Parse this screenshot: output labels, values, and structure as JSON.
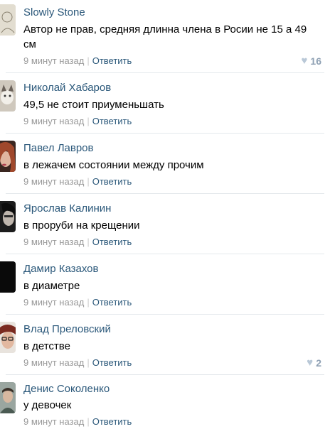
{
  "colors": {
    "author": "#2b587a",
    "meta": "#999999",
    "divider": "#e4e8ec",
    "like": "#8fa1b4"
  },
  "comments": [
    {
      "author": "Slowly Stone",
      "text": "Автор не прав, средняя длинна члена в Росии не 15 а 49 см",
      "time": "9 минут назад",
      "separator": "|",
      "reply": "Ответить",
      "likes": "16",
      "like_icon": "heart-icon",
      "avatar": "avatar-sketch"
    },
    {
      "author": "Николай Хабаров",
      "text": "49,5 не стоит приуменьшать",
      "time": "9 минут назад",
      "separator": "|",
      "reply": "Ответить",
      "avatar": "avatar-cat"
    },
    {
      "author": "Павел Лавров",
      "text": "в лежачем состоянии между прочим",
      "time": "9 минут назад",
      "separator": "|",
      "reply": "Ответить",
      "avatar": "avatar-woman-redhead"
    },
    {
      "author": "Ярослав Калинин",
      "text": "в проруби на крещении",
      "time": "9 минут назад",
      "separator": "|",
      "reply": "Ответить",
      "avatar": "avatar-dark-face"
    },
    {
      "author": "Дамир Казахов",
      "text": "в диаметре",
      "time": "9 минут назад",
      "separator": "|",
      "reply": "Ответить",
      "avatar": "avatar-black"
    },
    {
      "author": "Влад Преловский",
      "text": "в детстве",
      "time": "9 минут назад",
      "separator": "|",
      "reply": "Ответить",
      "likes": "2",
      "like_icon": "heart-icon",
      "avatar": "avatar-glasses"
    },
    {
      "author": "Денис Соколенко",
      "text": "у девочек",
      "time": "9 минут назад",
      "separator": "|",
      "reply": "Ответить",
      "avatar": "avatar-man"
    }
  ]
}
